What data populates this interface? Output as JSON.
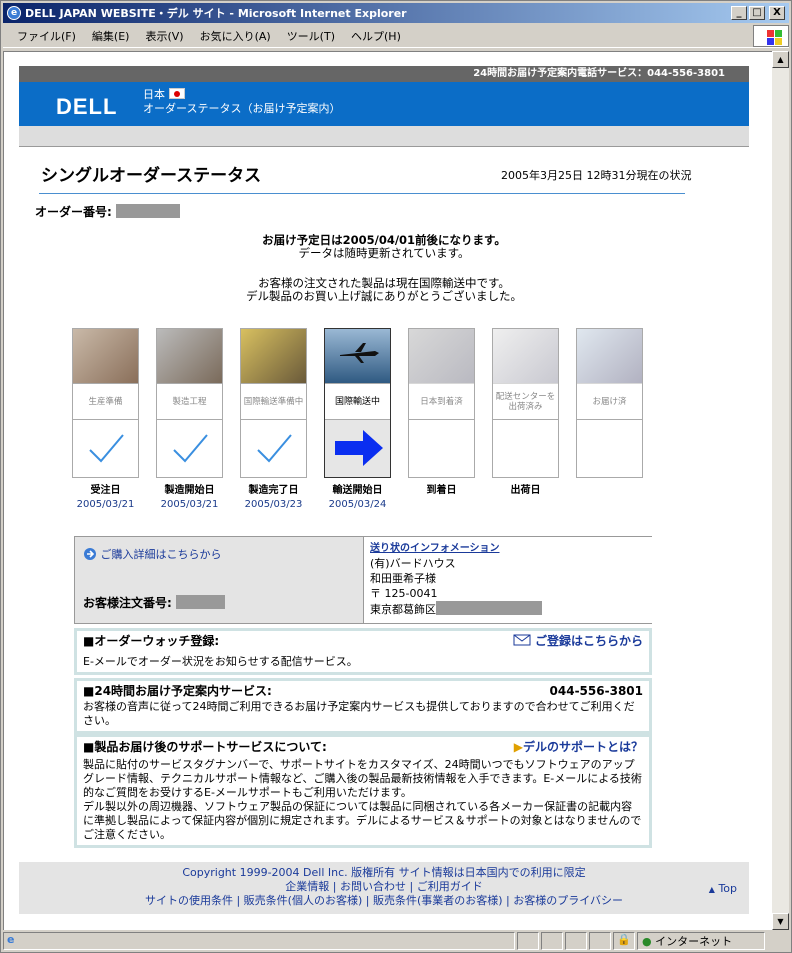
{
  "window": {
    "title": "DELL JAPAN WEBSITE・デル サイト - Microsoft Internet Explorer",
    "btn_min": "_",
    "btn_max": "□",
    "btn_close": "X"
  },
  "menu": [
    "ファイル(F)",
    "編集(E)",
    "表示(V)",
    "お気に入り(A)",
    "ツール(T)",
    "ヘルプ(H)"
  ],
  "status": {
    "zone": "インターネット"
  },
  "header": {
    "hotline": "24時間お届け予定案内電話サービス：044-556-3801",
    "logo": "DELL",
    "country": "日本",
    "subtitle": "オーダーステータス（お届け予定案内）"
  },
  "page": {
    "title": "シングルオーダーステータス",
    "timestamp": "2005年3月25日 12時31分現在の状況",
    "order_label": "オーダー番号:"
  },
  "message": {
    "line1": "お届け予定日は2005/04/01前後になります。",
    "line2": "データは随時更新されています。",
    "line3": "お客様の注文された製品は現在国際輸送中です。",
    "line4": "デル製品のお買い上げ誠にありがとうございました。"
  },
  "stages": [
    {
      "label": "生産準備",
      "status": "受注日",
      "date": "2005/03/21"
    },
    {
      "label": "製造工程",
      "status": "製造開始日",
      "date": "2005/03/21"
    },
    {
      "label": "国際輸送準備中",
      "status": "製造完了日",
      "date": "2005/03/23"
    },
    {
      "label": "国際輸送中",
      "status": "輸送開始日",
      "date": "2005/03/24"
    },
    {
      "label": "日本到着済",
      "status": "到着日",
      "date": ""
    },
    {
      "label": "配送センターを出荷済み",
      "status": "出荷日",
      "date": ""
    },
    {
      "label": "お届け済",
      "status": "",
      "date": ""
    }
  ],
  "info": {
    "detail_link": "ご購入詳細はこちらから",
    "customer_order_label": "お客様注文番号:",
    "shipping_title": "送り状のインフォメーション",
    "company": "(有)バードハウス",
    "name": "和田亜希子様",
    "postal": "〒 125-0041",
    "address": "東京都葛飾区"
  },
  "watch": {
    "title": "■オーダーウォッチ登録:",
    "link": "ご登録はこちらから",
    "desc": "E-メールでオーダー状況をお知らせする配信サービス。"
  },
  "hotline": {
    "title": "■24時間お届け予定案内サービス:",
    "phone": "044-556-3801",
    "desc": "お客様の音声に従って24時間ご利用できるお届け予定案内サービスも提供しておりますので合わせてご利用ください。"
  },
  "support": {
    "title": "■製品お届け後のサポートサービスについて:",
    "link": "デルのサポートとは？",
    "desc1": "製品に貼付のサービスタグナンバーで、サポートサイトをカスタマイズ、24時間いつでもソフトウェアのアップグレード情報、テクニカルサポート情報など、ご購入後の製品最新技術情報を入手できます。E-メールによる技術的なご質問をお受けするE-メールサポートもご利用いただけます。",
    "desc2": "デル製以外の周辺機器、ソフトウェア製品の保証については製品に同梱されている各メーカー保証書の記載内容に準拠し製品によって保証内容が個別に規定されます。デルによるサービス＆サポートの対象とはなりませんのでご注意ください。"
  },
  "footer": {
    "copyright": "Copyright 1999-2004 Dell Inc. 版権所有 サイト情報は日本国内での利用に限定",
    "link1": "企業情報",
    "link2": "お問い合わせ",
    "link3": "ご利用ガイド",
    "link4": "サイトの使用条件",
    "link5": "販売条件(個人のお客様)",
    "link6": "販売条件(事業者のお客様)",
    "link7": "お客様のプライバシー",
    "top": "Top"
  },
  "colors": {
    "dell_blue": "#0b6dc7",
    "arrow": "#0a2ef0",
    "check": "#3a8fe0"
  }
}
